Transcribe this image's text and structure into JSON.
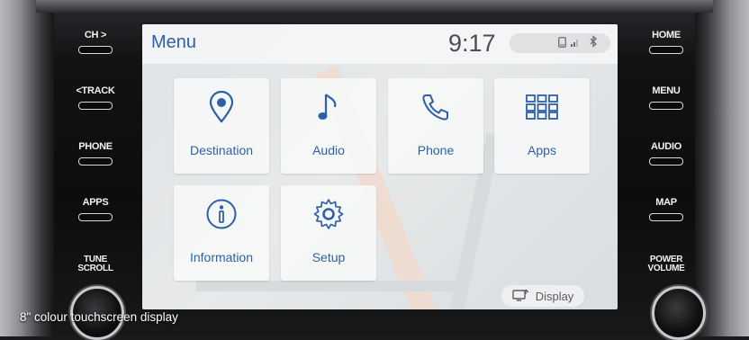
{
  "left_buttons": [
    {
      "label": "CH >"
    },
    {
      "label": "<TRACK"
    },
    {
      "label": "PHONE"
    },
    {
      "label": "APPS"
    }
  ],
  "left_knob": {
    "label_line1": "TUNE",
    "label_line2": "SCROLL"
  },
  "right_buttons": [
    {
      "label": "HOME"
    },
    {
      "label": "MENU"
    },
    {
      "label": "AUDIO"
    },
    {
      "label": "MAP"
    }
  ],
  "right_knob": {
    "label_line1": "POWER",
    "label_line2": "VOLUME"
  },
  "screen": {
    "title": "Menu",
    "clock": "9:17",
    "status_icons": [
      "phone-icon",
      "signal-icon",
      "bluetooth-icon"
    ],
    "tiles": [
      {
        "label": "Destination",
        "icon": "location-pin-icon"
      },
      {
        "label": "Audio",
        "icon": "music-note-icon"
      },
      {
        "label": "Phone",
        "icon": "phone-handset-icon"
      },
      {
        "label": "Apps",
        "icon": "apps-grid-icon"
      },
      {
        "label": "Information",
        "icon": "info-icon"
      },
      {
        "label": "Setup",
        "icon": "gear-icon"
      }
    ],
    "display_button": {
      "label": "Display",
      "icon": "display-icon"
    },
    "accent_color": "#2f5fa8"
  },
  "caption": "8\" colour touchscreen display"
}
